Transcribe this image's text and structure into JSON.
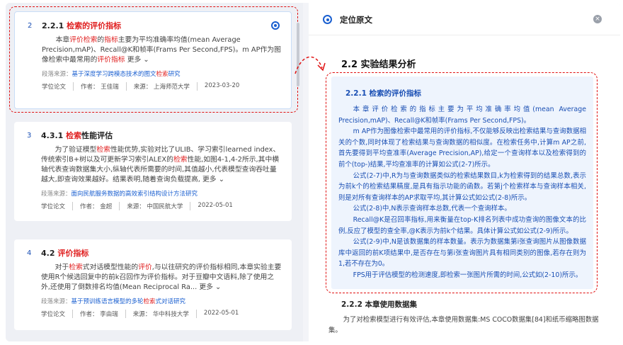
{
  "results": [
    {
      "num": "2",
      "title_prefix": "2.2.1 ",
      "title_hl": "检索的评价指标",
      "title_suffix": "",
      "body_1": "本章",
      "body_hl1": "评价检索",
      "body_2": "的",
      "body_hl2": "指标",
      "body_3": "主要为平均准确率均值(mean Average Precision,mAP)、Recall@K和帧率(Frams Per Second,FPS)。m AP作为图像检索中最常用的",
      "body_hl3": "评价指标",
      "more": "更多",
      "src_label": "段落来源：",
      "src_1": "基于深度学习跨模态技术的图文",
      "src_hl": "检索",
      "src_2": "研究",
      "type": "学位论文",
      "author": "作者： 王佳瑞",
      "source": "来源： 上海师范大学",
      "date": "2023-03-20"
    },
    {
      "num": "3",
      "title_prefix": "4.3.1 ",
      "title_hl": "检索",
      "title_suffix": "性能评估",
      "body_1": "为了验证模型",
      "body_hl1": "检索",
      "body_2": "性能优势,实验对比了ULIB、学习索引learned index、传统索引B+树以及可更新学习索引ALEX的",
      "body_hl2": "检索",
      "body_3": "性能,如图4-1,4-2所示,其中横轴代表查询数据集大小,纵轴代表所需要的时间,其值越小,代表模型查询吞吐量越大,即查询效果越好。结果表明,随着查询负载提高,",
      "body_hl3": "",
      "more": "更多",
      "src_label": "段落来源：",
      "src_1": "面向民航服务数据的高效索引结构设计方法研究",
      "src_hl": "",
      "src_2": "",
      "type": "学位论文",
      "author": "作者： 金超",
      "source": "来源： 中国民航大学",
      "date": "2022-05-01"
    },
    {
      "num": "4",
      "title_prefix": "4.2 ",
      "title_hl": "评价指标",
      "title_suffix": "",
      "body_1": "对于",
      "body_hl1": "检索",
      "body_2": "式对话模型性能的",
      "body_hl2": "评价",
      "body_3": ",与以往研究的评价指标相同,本章实验主要使用R个候选回复中的前k召回作为评价指标。对于豆瓣中文语料,除了使用之外,还使用了倒数排名均值(Mean Reciprocal Ra...",
      "body_hl3": "",
      "more": "更多",
      "src_label": "段落来源：",
      "src_1": "基于预训练语言模型的多轮",
      "src_hl": "检索",
      "src_2": "式对话研究",
      "type": "学位论文",
      "author": "作者： 李由瑞",
      "source": "来源： 华中科技大学",
      "date": "2022-05-01"
    }
  ],
  "right": {
    "header": "定位原文",
    "close": "×",
    "section": "2.2 实验结果分析",
    "subsection": "2.2.1 检索的评价指标",
    "paragraphs": [
      "本章评价检索的指标主要为平均准确率均值(mean Average Precision,mAP)、Recall@K和帧率(Frams Per Second,FPS)。",
      "m AP作为图像检索中最常用的评价指标,不仅能够反映出检索结果与查询数据相关的个数,同时体现了检索结果与查询数据的相似度。在检索任务中,计算m AP之前,首先要得到平均查准率(Average Precision,AP),给定一个查询样本以及检索得到的前个(top-)结果,平均查准率的计算如公式(2-7)所示。",
      "公式(2-7)中,R为与查询数据类似的检索结果数目,k为检索得到的结果总数,表示为前k个的检索结果精度,是具有指示功能的函数。若第j个检索样本与查询样本相关,则是对所有查询样本的AP求取平均,其计算公式如公式(2-8)所示。",
      "公式(2-8)中,N表示查询样本总数,代表一个查询样本。",
      "Recall@K是召回率指标,用来衡量在top-K排名列表中成功查询的图像文本的比例,反应了模型的查全率,@K表示为前k个结果。具体计算公式如公式(2-9)所示。",
      "公式(2-9)中,N是该数据集的样本数量。表示为数据集第i张查询图片从图像数据库中返回的前K项结果中,是否存在与第i张查询图片具有相同类别的图像,若存在则为1,若不存在为0。",
      "FPS用于评估模型的检测速度,即检索一张图片所需的时间,公式如(2-10)所示。"
    ],
    "section2": "2.2.2 本章使用数据集",
    "paragraph2": "为了对检索模型进行有效评估,本章使用数据集:MS COCO数据集[84]和纸币缩略图数据集。"
  },
  "colors": {
    "accent": "#1a5fd0",
    "highlight": "#e02020",
    "dashed": "#e01010",
    "doc_bg": "#eef4fd"
  }
}
